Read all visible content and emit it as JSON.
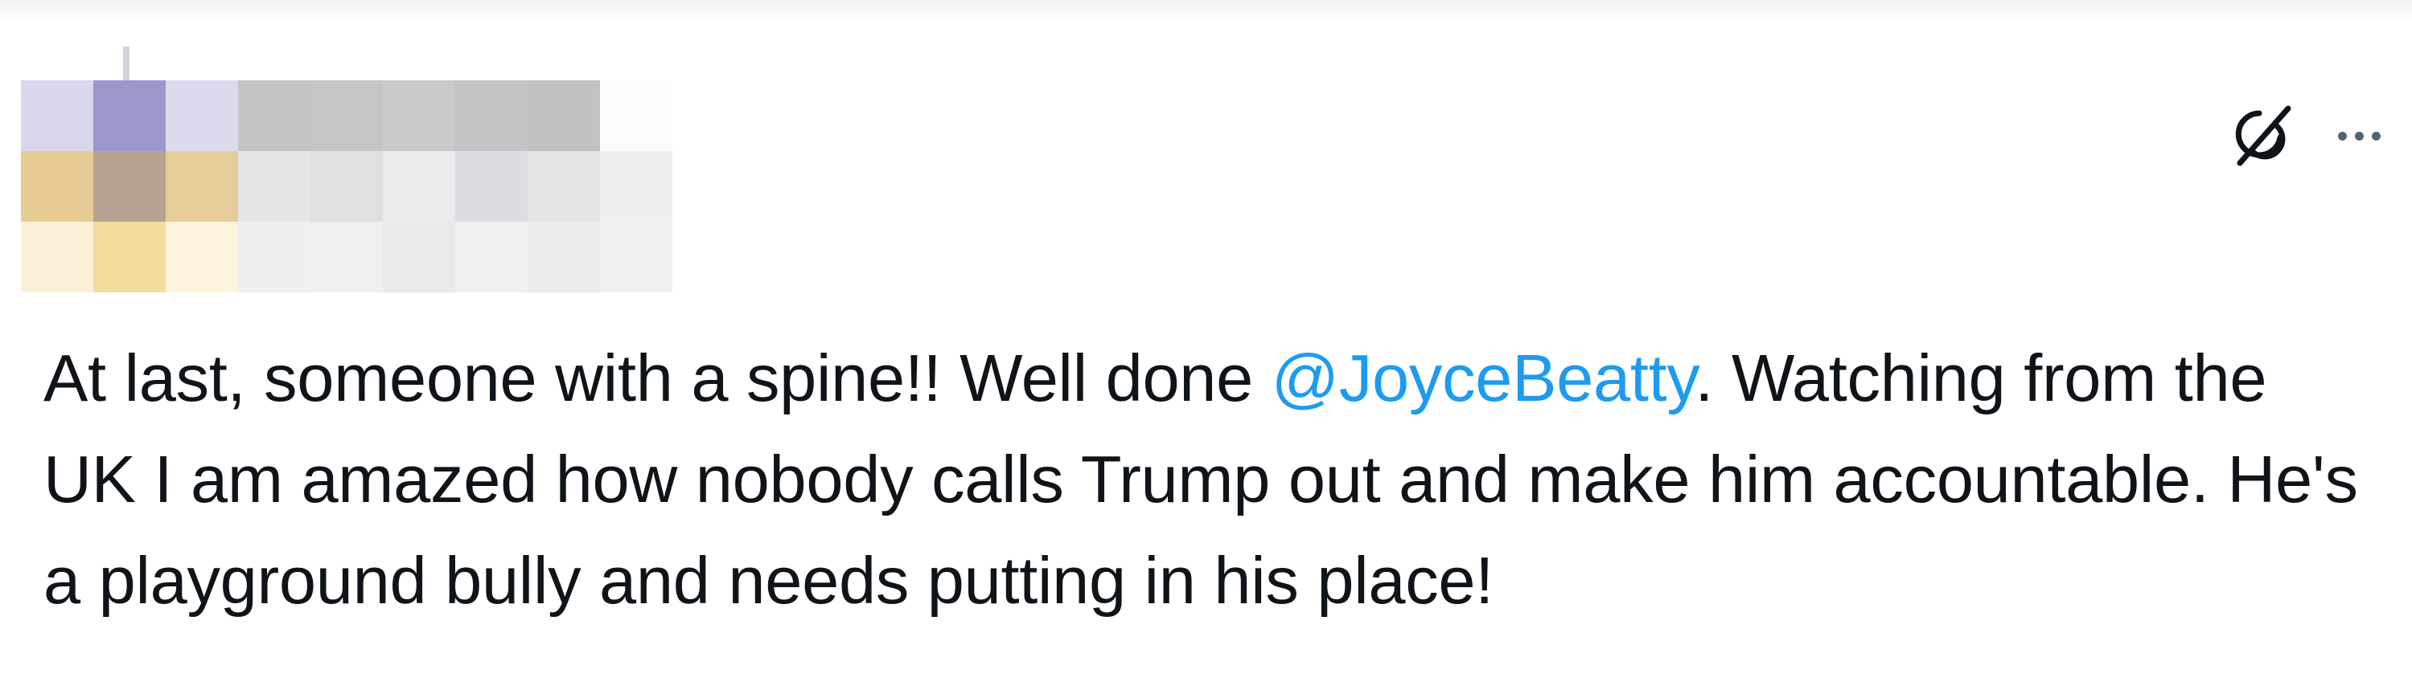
{
  "tweet": {
    "text_before": "At last, someone with a spine!! Well done ",
    "mention": "@JoyceBeatty",
    "text_after": ". Watching from the UK I am amazed how nobody calls Trump out and make him accountable. He's a playground bully and needs putting in his place!"
  },
  "actions": {
    "grok_icon": "grok-icon",
    "more_icon": "more-options-icon"
  },
  "colors": {
    "text": "#0f1419",
    "mention": "#1d9bf0",
    "icon": "#536471"
  },
  "avatar_pixels": [
    [
      "#d9d7ec",
      "#9b98cc",
      "#dcdbee",
      "#c3c4c6",
      "#c4c5c7",
      "#c9cacc",
      "#c3c4c6",
      "#c1c2c4",
      "#fbfbfb"
    ],
    [
      "#e6cc94",
      "#b8a293",
      "#e6cc98",
      "#e5e6e8",
      "#dfe0e2",
      "#eaebed",
      "#dcdde0",
      "#e4e5e7",
      "#eeeff0"
    ],
    [
      "#fcf1d6",
      "#f2dc9e",
      "#fdf4dd",
      "#eeeff0",
      "#eff0f1",
      "#e9eaec",
      "#eef0f1",
      "#eaebed",
      "#f0f1f2"
    ]
  ]
}
